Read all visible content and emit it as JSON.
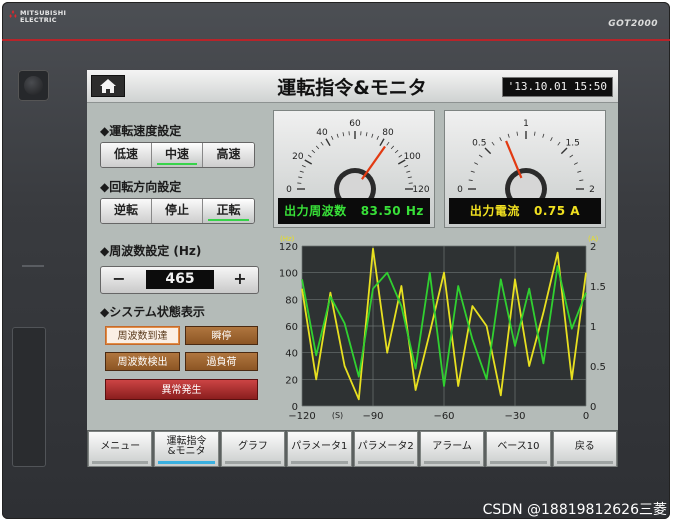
{
  "device": {
    "brand_line1": "MITSUBISHI",
    "brand_line2": "ELECTRIC",
    "model": "GOT2000"
  },
  "screen": {
    "title": "運転指令&モニタ",
    "datetime": "'13.10.01 15:50",
    "home_icon": "home-icon"
  },
  "speed_setting": {
    "heading": "◆運転速度設定",
    "options": [
      "低速",
      "中速",
      "高速"
    ],
    "selected": "中速"
  },
  "direction_setting": {
    "heading": "◆回転方向設定",
    "options": [
      "逆転",
      "停止",
      "正転"
    ],
    "selected": "正転"
  },
  "frequency_setting": {
    "heading": "◆周波数設定 (Hz)",
    "minus": "−",
    "plus": "+",
    "value": "465"
  },
  "system_status": {
    "heading": "◆システム状態表示",
    "lamps": [
      {
        "label": "周波数到達",
        "state": "on"
      },
      {
        "label": "瞬停",
        "state": "off"
      },
      {
        "label": "周波数検出",
        "state": "off"
      },
      {
        "label": "過負荷",
        "state": "off"
      }
    ],
    "alarm": "異常発生"
  },
  "frequency_meter": {
    "ticks": [
      "0",
      "20",
      "40",
      "60",
      "80",
      "100",
      "120"
    ],
    "min": 0,
    "max": 120,
    "value": 83.5,
    "label": "出力周波数",
    "reading": "83.50 Hz",
    "label_color": "#38e038"
  },
  "current_meter": {
    "ticks": [
      "0",
      "0.5",
      "1",
      "1.5",
      "2"
    ],
    "min": 0,
    "max": 2,
    "value": 0.75,
    "label": "出力電流",
    "reading": "0.75 A",
    "label_color": "#f0e020"
  },
  "chart_data": {
    "type": "line",
    "xlabel": "(S)",
    "ylabel_left": "(Hz)",
    "ylabel_right": "(A)",
    "xlim": [
      -120,
      0
    ],
    "ylim_left": [
      0,
      120
    ],
    "ylim_right": [
      0,
      2
    ],
    "x_ticks": [
      "−120",
      "−90",
      "−60",
      "−30",
      "0"
    ],
    "y_left_ticks": [
      "0",
      "20",
      "40",
      "60",
      "80",
      "100",
      "120"
    ],
    "y_right_ticks": [
      "0",
      "0.5",
      "1",
      "1.5",
      "2"
    ],
    "grid": true,
    "series": [
      {
        "axis": "left",
        "color": "#e8e020",
        "x": [
          -120,
          -114,
          -108,
          -102,
          -96,
          -90,
          -84,
          -78,
          -72,
          -66,
          -60,
          -54,
          -48,
          -42,
          -36,
          -30,
          -24,
          -18,
          -12,
          -6,
          0
        ],
        "y": [
          88,
          20,
          85,
          30,
          5,
          118,
          40,
          90,
          12,
          55,
          100,
          15,
          75,
          60,
          8,
          95,
          30,
          70,
          115,
          20,
          100
        ]
      },
      {
        "axis": "left",
        "color": "#30d030",
        "x": [
          -120,
          -114,
          -108,
          -102,
          -96,
          -90,
          -84,
          -78,
          -72,
          -66,
          -60,
          -54,
          -48,
          -42,
          -36,
          -30,
          -24,
          -18,
          -12,
          -6,
          0
        ],
        "y": [
          95,
          38,
          82,
          62,
          22,
          88,
          100,
          75,
          28,
          100,
          15,
          90,
          50,
          20,
          95,
          45,
          88,
          32,
          105,
          58,
          85
        ]
      }
    ]
  },
  "menu": {
    "items": [
      "メニュー",
      "運転指令\n&モニタ",
      "グラフ",
      "パラメータ1",
      "パラメータ2",
      "アラーム",
      "ベース10",
      "戻る"
    ],
    "active_index": 1
  },
  "watermark": "CSDN @18819812626三菱",
  "colors": {
    "alarm": "#b02a2a",
    "lamp_off": "#a2652f",
    "chart_bg": "#2e3233"
  }
}
